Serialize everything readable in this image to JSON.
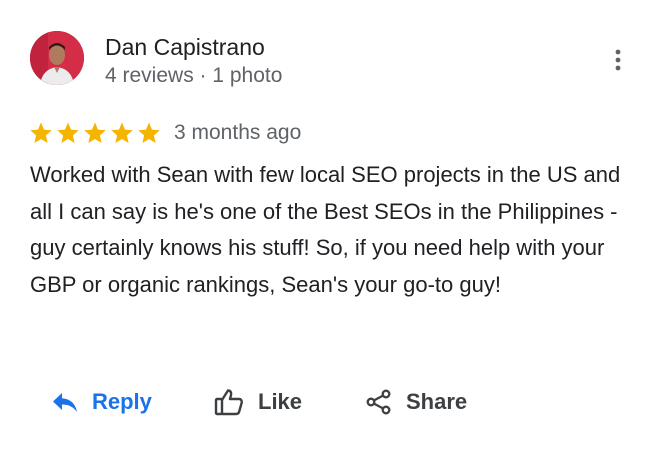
{
  "review": {
    "reviewer_name": "Dan Capistrano",
    "reviewer_meta": "4 reviews · 1 photo",
    "rating": 5,
    "rating_max": 5,
    "date": "3 months ago",
    "text": "Worked with Sean with few local SEO projects in the US and all I can say is he's one of the Best SEOs in the Philippines - guy certainly knows his stuff! So, if you need help with your GBP or organic rankings, Sean's your go-to guy!"
  },
  "actions": {
    "reply_label": "Reply",
    "like_label": "Like",
    "share_label": "Share"
  },
  "icons": {
    "more": "more-vertical-icon",
    "star": "star-icon",
    "reply": "reply-icon",
    "like": "thumbs-up-icon",
    "share": "share-icon"
  },
  "colors": {
    "star": "#f4b400",
    "reply": "#1a73e8",
    "text": "#202124",
    "secondary": "#5f6368"
  }
}
